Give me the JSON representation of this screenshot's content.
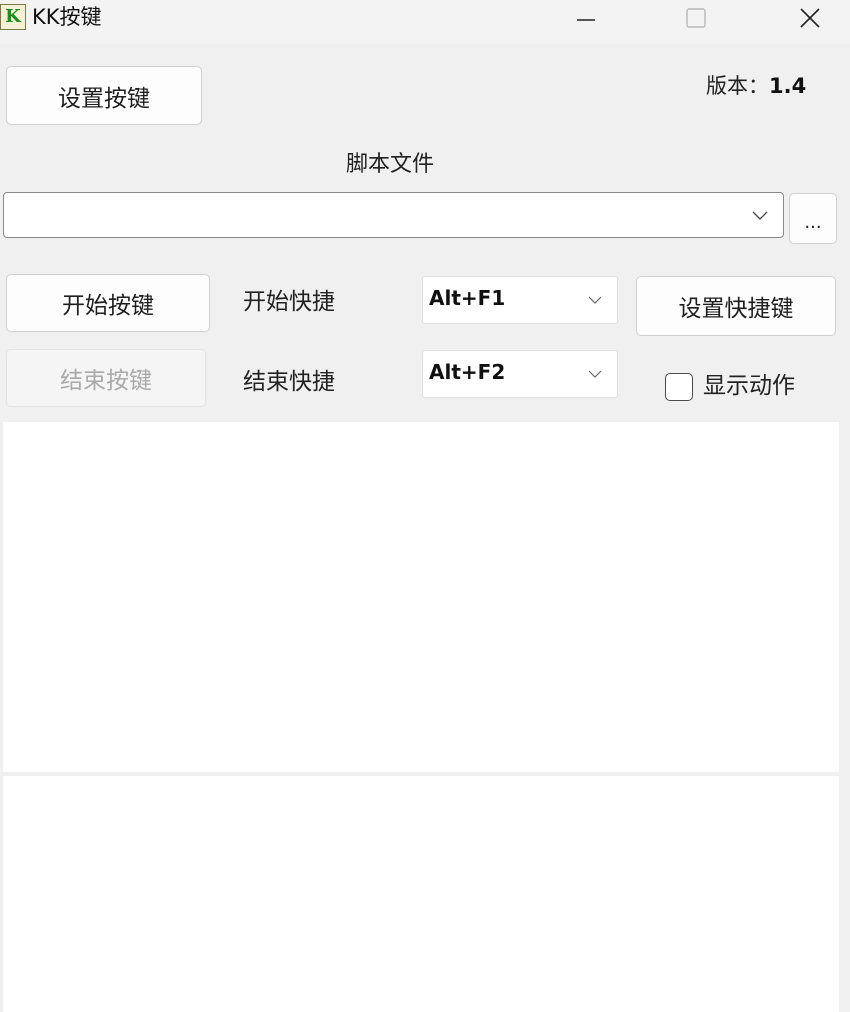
{
  "window": {
    "title": "KK按键",
    "icon_letter": "K",
    "controls": [
      "minimize-icon",
      "maximize-icon",
      "close-icon"
    ]
  },
  "toolbar": {
    "set_keys_label": "设置按键",
    "version_key": "版本：",
    "version_value": "1.4"
  },
  "script": {
    "label": "脚本文件",
    "path_value": "",
    "browse_label": "..."
  },
  "controls": {
    "start_button": "开始按键",
    "start_hotkey_label": "开始快捷",
    "start_hotkey_value": "Alt+F1",
    "set_hotkey_button": "设置快捷键",
    "stop_button": "结束按键",
    "stop_hotkey_label": "结束快捷",
    "stop_hotkey_value": "Alt+F2",
    "show_actions_label": "显示动作",
    "show_actions_checked": false
  },
  "colors": {
    "window_bg": "#f0f0f0",
    "panel_bg": "#ffffff",
    "icon_green": "#1c8c1c"
  }
}
